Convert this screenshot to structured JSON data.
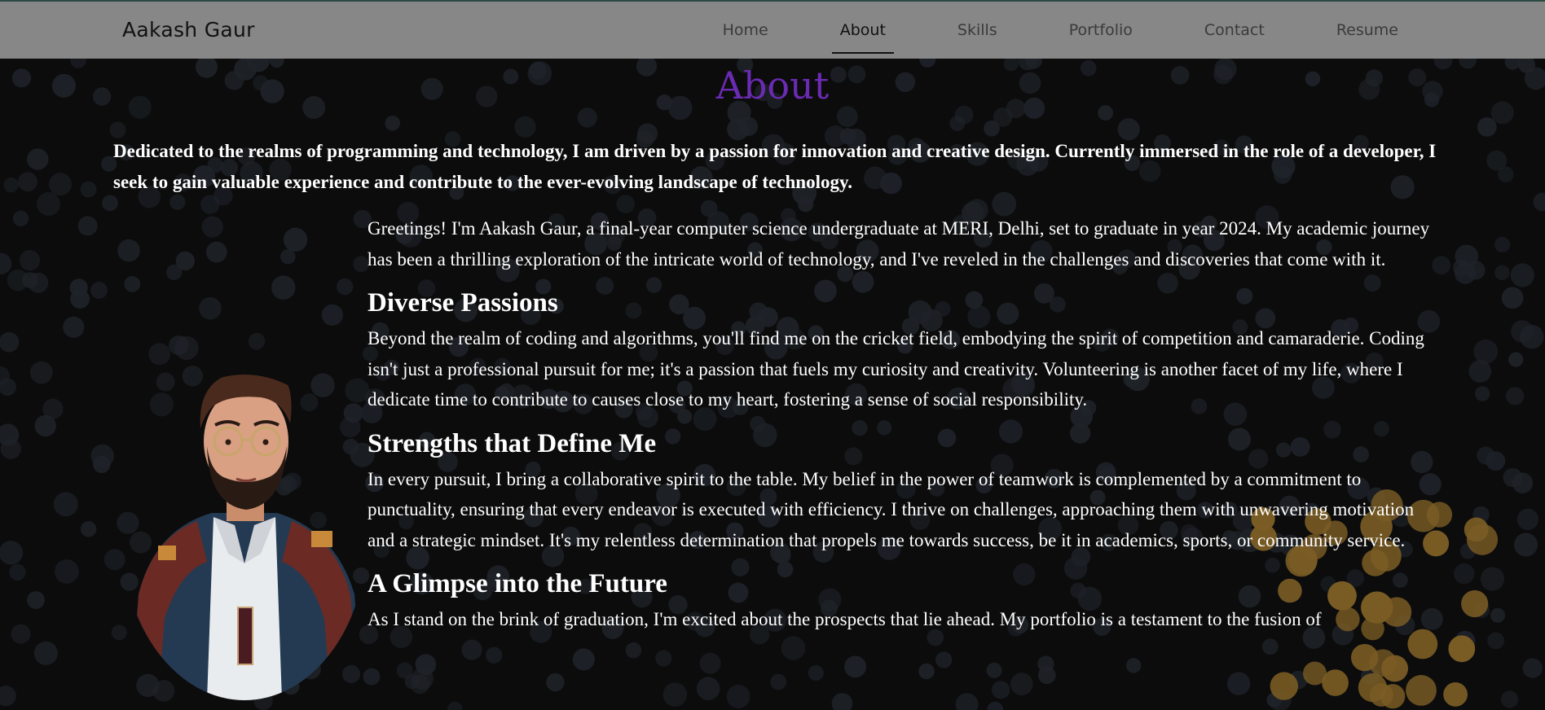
{
  "navbar": {
    "brand": "Aakash Gaur",
    "links": [
      {
        "label": "Home",
        "active": false
      },
      {
        "label": "About",
        "active": true
      },
      {
        "label": "Skills",
        "active": false
      },
      {
        "label": "Portfolio",
        "active": false
      },
      {
        "label": "Contact",
        "active": false
      },
      {
        "label": "Resume",
        "active": false
      }
    ]
  },
  "about": {
    "title": "About",
    "intro": "Dedicated to the realms of programming and technology, I am driven by a passion for innovation and creative design. Currently immersed in the role of a developer, I seek to gain valuable experience and contribute to the ever-evolving landscape of technology.",
    "greeting": "Greetings! I'm Aakash Gaur, a final-year computer science undergraduate at MERI, Delhi, set to graduate in year 2024. My academic journey has been a thrilling exploration of the intricate world of technology, and I've reveled in the challenges and discoveries that come with it.",
    "sections": [
      {
        "heading": "Diverse Passions",
        "body": "Beyond the realm of coding and algorithms, you'll find me on the cricket field, embodying the spirit of competition and camaraderie. Coding isn't just a professional pursuit for me; it's a passion that fuels my curiosity and creativity. Volunteering is another facet of my life, where I dedicate time to contribute to causes close to my heart, fostering a sense of social responsibility."
      },
      {
        "heading": "Strengths that Define Me",
        "body": "In every pursuit, I bring a collaborative spirit to the table. My belief in the power of teamwork is complemented by a commitment to punctuality, ensuring that every endeavor is executed with efficiency. I thrive on challenges, approaching them with unwavering motivation and a strategic mindset. It's my relentless determination that propels me towards success, be it in academics, sports, or community service."
      },
      {
        "heading": "A Glimpse into the Future",
        "body": "As I stand on the brink of graduation, I'm excited about the prospects that lie ahead. My portfolio is a testament to the fusion of"
      }
    ],
    "avatar_icon": "developer-avatar-illustration"
  },
  "colors": {
    "background": "#0c0c0d",
    "navbar": "#878787",
    "title_accent": "#6a2bb2",
    "dots": "#1f2329",
    "gold_dots": "#7a5c24"
  }
}
